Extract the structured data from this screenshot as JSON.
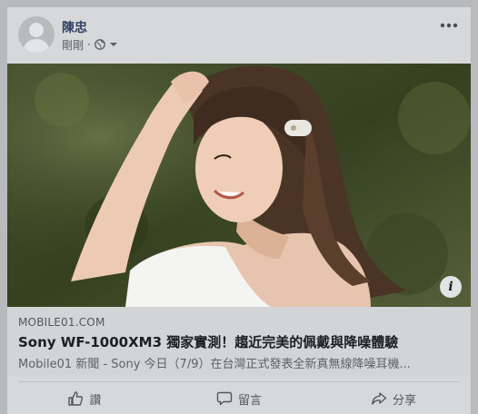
{
  "post": {
    "author": "陳忠",
    "timestamp": "剛剛",
    "audience_icon": "globe-icon",
    "more_icon": "more-dots-icon"
  },
  "link": {
    "domain": "MOBILE01.COM",
    "title": "Sony WF-1000XM3 獨家實測！趨近完美的佩戴與降噪體驗",
    "description": "Mobile01 新聞 - Sony 今日（7/9）在台灣正式發表全新真無線降噪耳機..."
  },
  "actions": {
    "like": "讚",
    "comment": "留言",
    "share": "分享"
  },
  "colors": {
    "name": "#2f3e63",
    "overlay_bg": "#b9babd"
  }
}
